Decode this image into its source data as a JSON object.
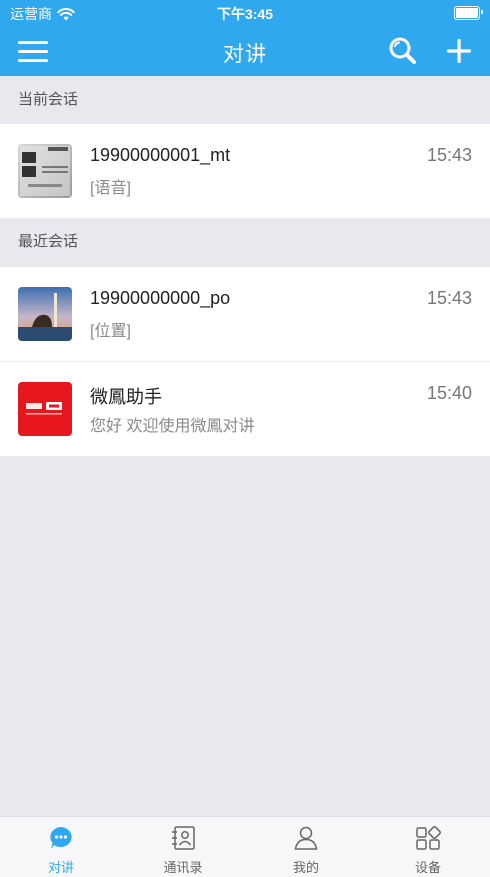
{
  "status_bar": {
    "carrier": "运营商",
    "time": "下午3:45"
  },
  "nav": {
    "title": "对讲"
  },
  "sections": {
    "current": "当前会话",
    "recent": "最近会话"
  },
  "current_sessions": [
    {
      "name": "19900000001_mt",
      "preview": "[语音]",
      "time": "15:43",
      "avatar": "book-cover-avatar"
    }
  ],
  "recent_sessions": [
    {
      "name": "19900000000_po",
      "preview": "[位置]",
      "time": "15:43",
      "avatar": "photo-avatar"
    },
    {
      "name": "微鳳助手",
      "preview": "您好 欢迎使用微鳳对讲",
      "time": "15:40",
      "avatar": "brand-avatar"
    }
  ],
  "tabs": [
    {
      "label": "对讲",
      "icon": "chat-bubble-icon",
      "active": true
    },
    {
      "label": "通讯录",
      "icon": "contacts-icon",
      "active": false
    },
    {
      "label": "我的",
      "icon": "profile-icon",
      "active": false
    },
    {
      "label": "设备",
      "icon": "devices-icon",
      "active": false
    }
  ],
  "colors": {
    "accent": "#2fa8f0",
    "background": "#e8e9ee",
    "brand_red": "#e8161d"
  }
}
